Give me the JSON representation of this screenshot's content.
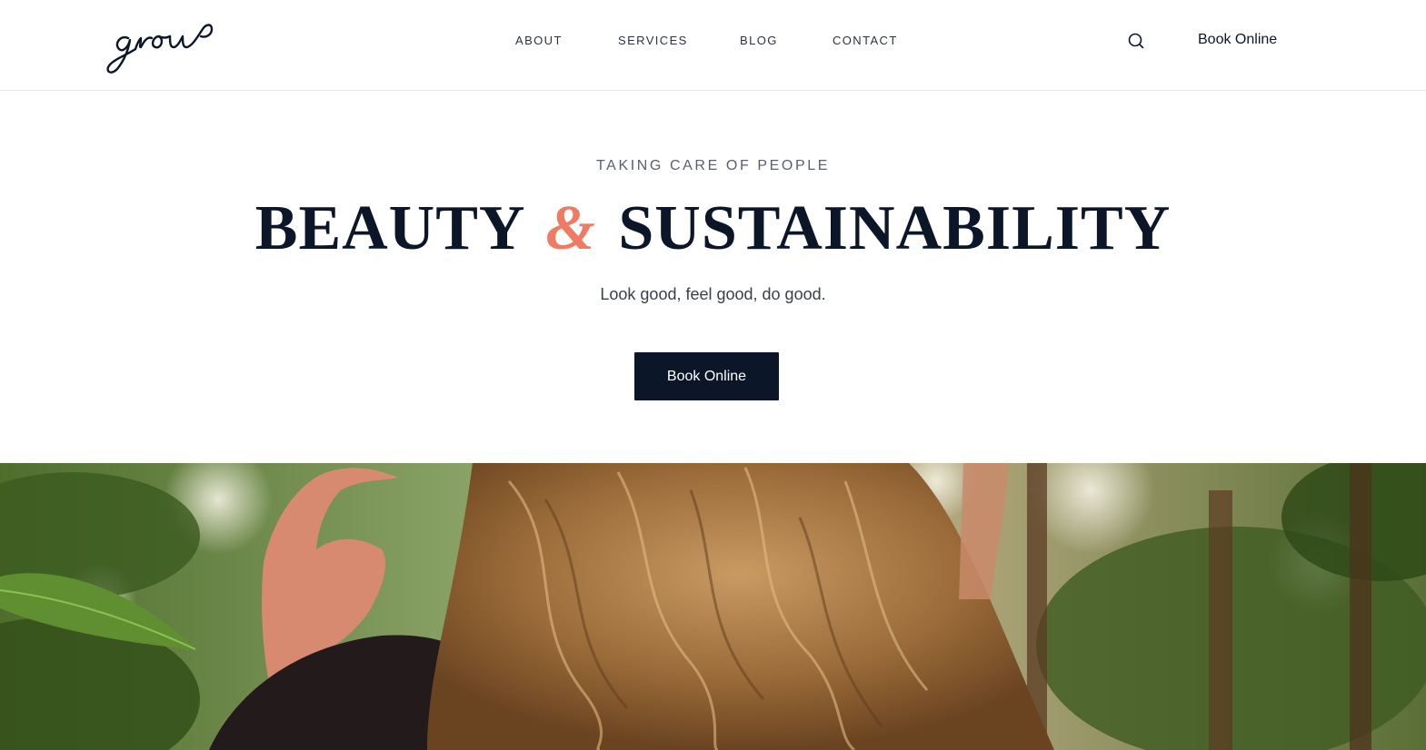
{
  "header": {
    "logo_text": "grow",
    "nav": [
      {
        "label": "ABOUT"
      },
      {
        "label": "SERVICES"
      },
      {
        "label": "BLOG"
      },
      {
        "label": "CONTACT"
      }
    ],
    "search_icon": "search-icon",
    "book_label": "Book Online"
  },
  "hero": {
    "eyebrow": "TAKING CARE OF PEOPLE",
    "headline_part1": "BEAUTY",
    "headline_amp": "&",
    "headline_part2": "SUSTAINABILITY",
    "tagline": "Look good, feel good, do good.",
    "cta_label": "Book Online"
  },
  "colors": {
    "navy": "#0b1629",
    "accent": "#ee7b62",
    "text_muted": "#5a5f69"
  },
  "image": {
    "semantic": "hero-photo-woman-hair-foliage"
  }
}
